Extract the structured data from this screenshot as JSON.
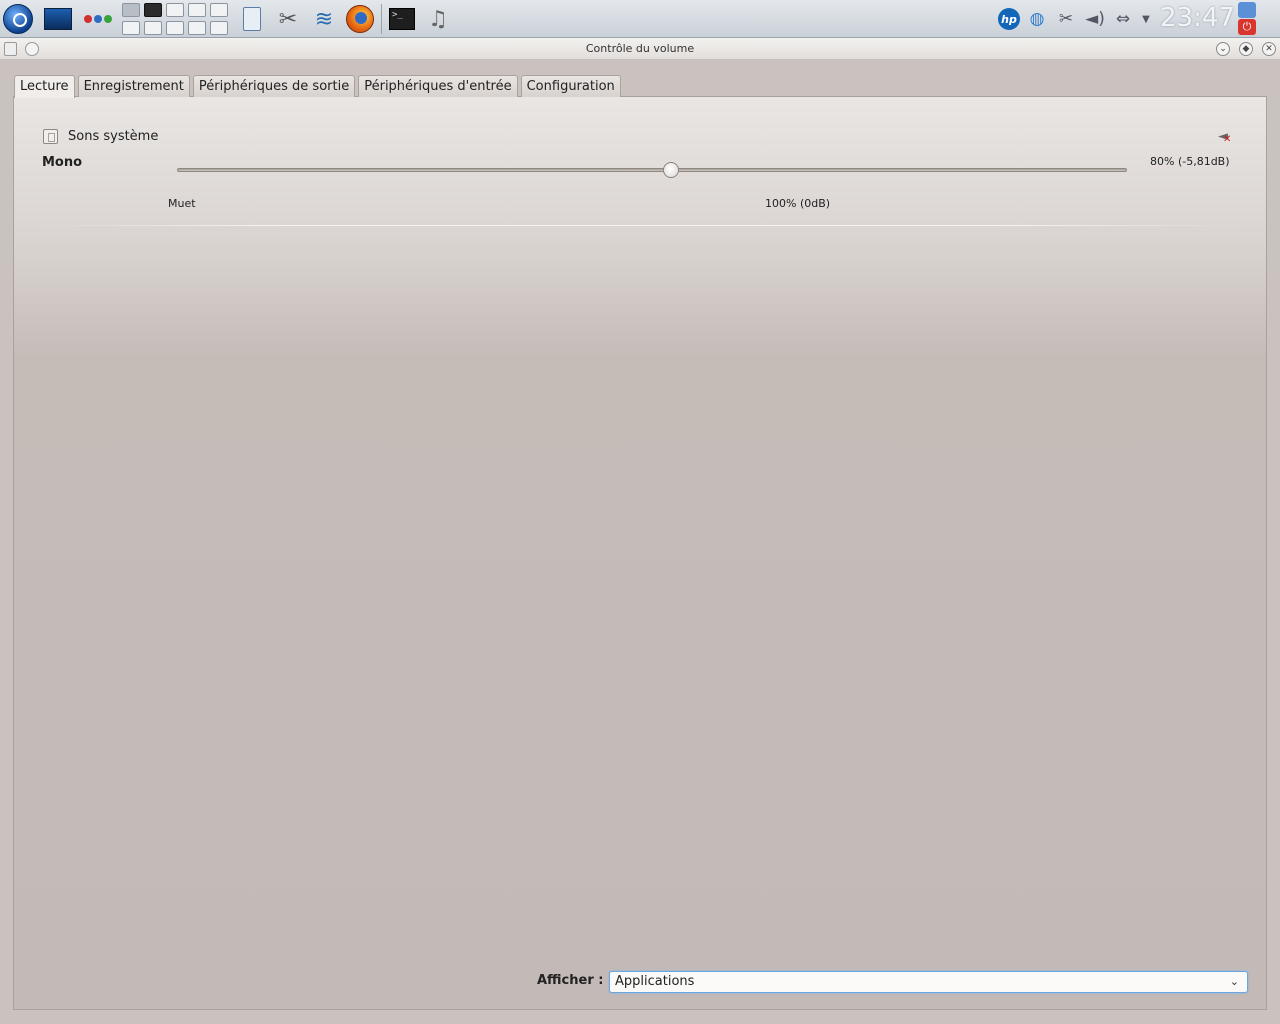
{
  "taskbar": {
    "clock": "23:47",
    "hp_label": "hp",
    "terminal_prompt": ">_"
  },
  "window": {
    "title": "Contrôle du volume"
  },
  "tabs": [
    {
      "label": "Lecture",
      "active": true
    },
    {
      "label": "Enregistrement",
      "active": false
    },
    {
      "label": "Périphériques de sortie",
      "active": false
    },
    {
      "label": "Périphériques d'entrée",
      "active": false
    },
    {
      "label": "Configuration",
      "active": false
    }
  ],
  "stream": {
    "name": "Sons système",
    "channel": "Mono",
    "volume_text": "80% (-5,81dB)",
    "volume_fraction": 0.52,
    "tick_min": "Muet",
    "tick_mid": "100% (0dB)"
  },
  "filter": {
    "label": "Afficher :",
    "selected": "Applications"
  },
  "colors": {
    "accent": "#6aa7e0",
    "mute_x": "#c72020"
  }
}
